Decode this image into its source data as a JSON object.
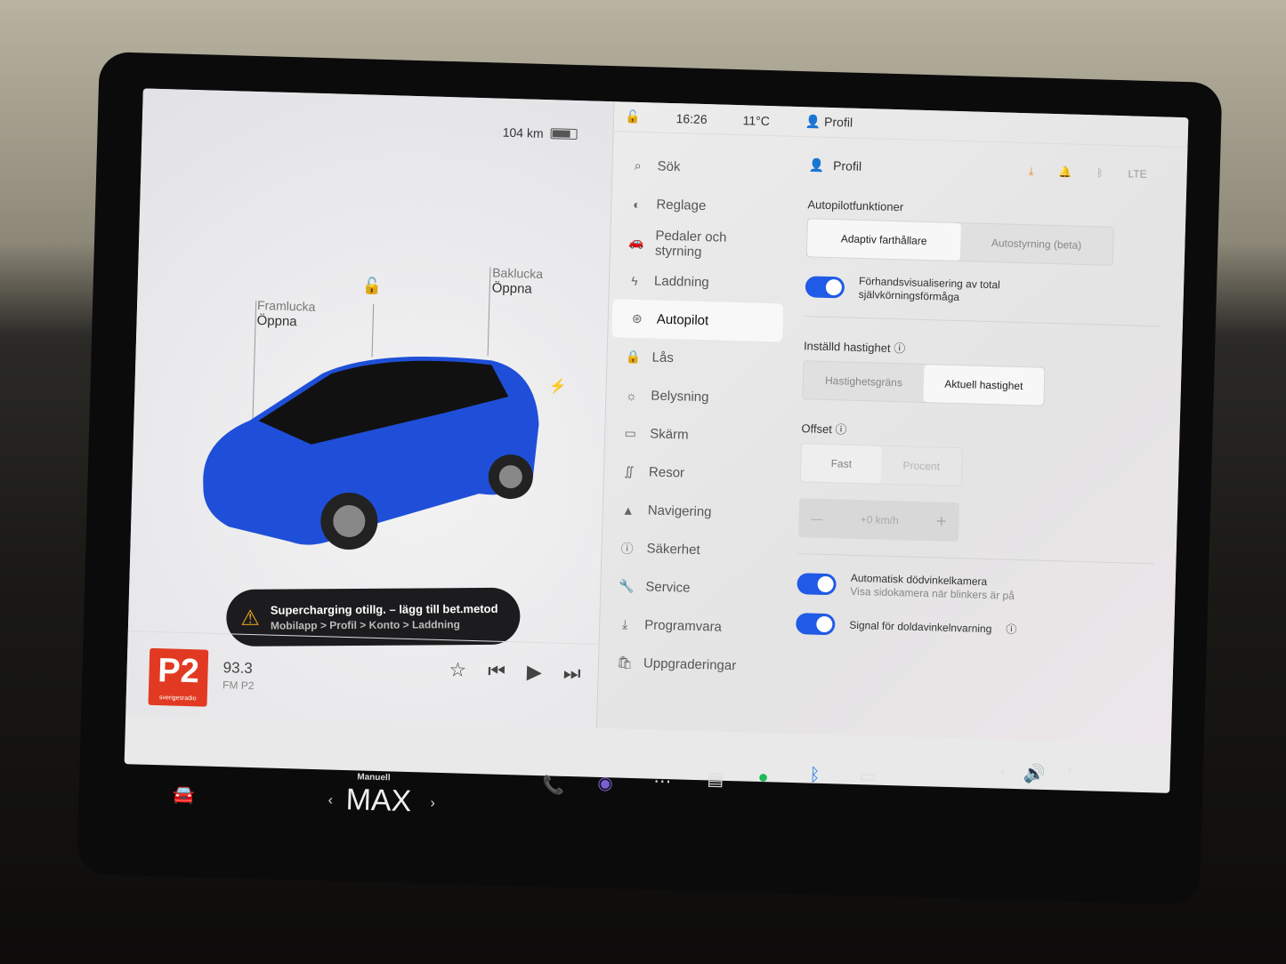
{
  "status": {
    "range": "104 km",
    "time": "16:26",
    "temp": "11°C",
    "profile": "Profil"
  },
  "car": {
    "frunk_label": "Framlucka",
    "frunk_action": "Öppna",
    "trunk_label": "Baklucka",
    "trunk_action": "Öppna",
    "color": "#1f4fd8"
  },
  "toast": {
    "title": "Supercharging otillg. – lägg till bet.metod",
    "subtitle": "Mobilapp > Profil > Konto > Laddning",
    "icon": "warning-icon"
  },
  "media": {
    "logo": "P2",
    "logo_sub": "sverigesradio",
    "frequency": "93.3",
    "band": "FM P2"
  },
  "nav": {
    "search": "Sök",
    "items": [
      {
        "label": "Reglage",
        "icon": "toggle-icon"
      },
      {
        "label": "Pedaler och styrning",
        "icon": "car-icon"
      },
      {
        "label": "Laddning",
        "icon": "bolt-icon"
      },
      {
        "label": "Autopilot",
        "icon": "steering-wheel-icon",
        "active": true
      },
      {
        "label": "Lås",
        "icon": "lock-icon"
      },
      {
        "label": "Belysning",
        "icon": "light-icon"
      },
      {
        "label": "Skärm",
        "icon": "display-icon"
      },
      {
        "label": "Resor",
        "icon": "trips-icon"
      },
      {
        "label": "Navigering",
        "icon": "navigation-icon"
      },
      {
        "label": "Säkerhet",
        "icon": "safety-icon"
      },
      {
        "label": "Service",
        "icon": "wrench-icon"
      },
      {
        "label": "Programvara",
        "icon": "download-icon"
      },
      {
        "label": "Uppgraderingar",
        "icon": "bag-icon"
      }
    ]
  },
  "settings": {
    "profile": "Profil",
    "autopilot_label": "Autopilotfunktioner",
    "autopilot_opts": [
      "Adaptiv farthållare",
      "Autostyrning (beta)"
    ],
    "fsd_preview": "Förhandsvisualisering av total självkörningsförmåga",
    "set_speed_label": "Inställd hastighet",
    "set_speed_opts": [
      "Hastighetsgräns",
      "Aktuell hastighet"
    ],
    "offset_label": "Offset",
    "offset_opts": [
      "Fast",
      "Procent"
    ],
    "offset_value": "+0 km/h",
    "blind_cam": "Automatisk dödvinkelkamera",
    "blind_cam_sub": "Visa sidokamera när blinkers är på",
    "blind_chime": "Signal för doldavinkelnvarning",
    "accent": "#1f5be6"
  },
  "taskbar": {
    "climate_mode": "Manuell",
    "fan": "MAX"
  }
}
